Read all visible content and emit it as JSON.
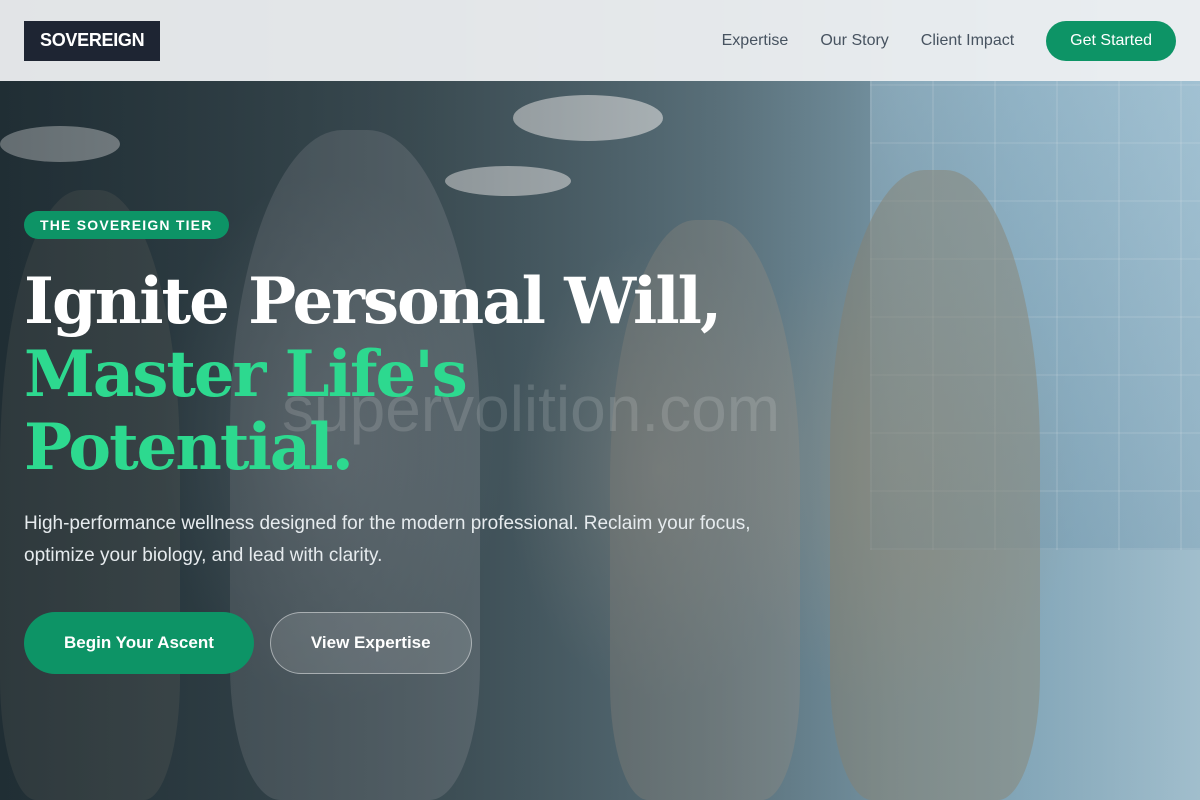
{
  "brand": {
    "name": "SOVEREIGN"
  },
  "nav": {
    "links": [
      "Expertise",
      "Our Story",
      "Client Impact"
    ],
    "cta_label": "Get Started"
  },
  "hero": {
    "badge": "THE SOVEREIGN TIER",
    "headline_line1": "Ignite Personal Will,",
    "headline_line2": "Master Life's",
    "headline_line3": "Potential.",
    "subtext": "High-performance wellness designed for the modern professional. Reclaim your focus, optimize your biology, and lead with clarity.",
    "primary_button": "Begin Your Ascent",
    "secondary_button": "View Expertise",
    "watermark": "supervolition.com",
    "background_image": "group-of-people-celebrating-in-office"
  },
  "colors": {
    "accent": "#0d9466",
    "headline_accent": "#2dd98f",
    "logo_bg": "#1e2533",
    "header_bg": "#eef0f2"
  }
}
